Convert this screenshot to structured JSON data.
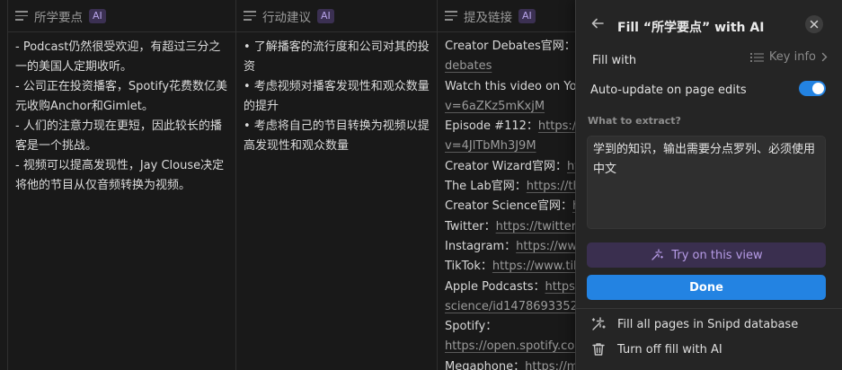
{
  "table": {
    "columns": [
      {
        "name": "所学要点",
        "badge": "AI"
      },
      {
        "name": "行动建议",
        "badge": "AI"
      },
      {
        "name": "提及链接",
        "badge": "AI"
      }
    ],
    "learnings": "- Podcast仍然很受欢迎，有超过三分之一的美国人定期收听。\n- 公司正在投资播客，Spotify花费数亿美元收购Anchor和Gimlet。\n- 人们的注意力现在更短，因此较长的播客是一个挑战。\n- 视频可以提高发现性，Jay Clouse决定将他的节目从仅音频转换为视频。",
    "actions": "• 了解播客的流行度和公司对其的投资\n• 考虑视频对播客发现性和观众数量的提升\n• 考虑将自己的节目转换为视频以提高发现性和观众数量",
    "links": [
      {
        "text": "Creator Debates官网：",
        "url": "h"
      },
      {
        "text": "",
        "url": "debates"
      },
      {
        "text": "Watch this video on You",
        "url": ""
      },
      {
        "text": "",
        "url": "v=6aZKz5mKxjM"
      },
      {
        "text": "Episode #112：",
        "url": "https://"
      },
      {
        "text": "",
        "url": "v=4JlTbMh3J9M"
      },
      {
        "text": "Creator Wizard官网：",
        "url": "ht"
      },
      {
        "text": "The Lab官网：",
        "url": "https://th"
      },
      {
        "text": "Creator Science官网：",
        "url": "h"
      },
      {
        "text": "Twitter：",
        "url": "https://twitter."
      },
      {
        "text": "Instagram：",
        "url": "https://www"
      },
      {
        "text": "TikTok：",
        "url": "https://www.tik"
      },
      {
        "text": "Apple Podcasts：",
        "url": "https:/"
      },
      {
        "text": "",
        "url": "science/id1478693352"
      },
      {
        "text": "Spotify：",
        "url": ""
      },
      {
        "text": "",
        "url": "https://open.spotify.com"
      },
      {
        "text": "Megaphone：",
        "url": "https://m"
      }
    ]
  },
  "panel": {
    "title": "Fill “所学要点” with AI",
    "fill_with_label": "Fill with",
    "fill_with_value": "Key info",
    "auto_update_label": "Auto-update on page edits",
    "auto_update_on": true,
    "extract_label": "What to extract?",
    "extract_value": "学到的知识，输出需要分点罗列、必须使用中文",
    "try_label": "Try on this view",
    "done_label": "Done",
    "menu": [
      {
        "label": "Fill all pages in Snipd database",
        "icon": "magic-wand-icon"
      },
      {
        "label": "Turn off fill with AI",
        "icon": "trash-icon"
      }
    ]
  },
  "colors": {
    "background": "#191919",
    "panel": "#252525",
    "accent_blue": "#2383e2",
    "ai_purple": "#b69be6"
  }
}
